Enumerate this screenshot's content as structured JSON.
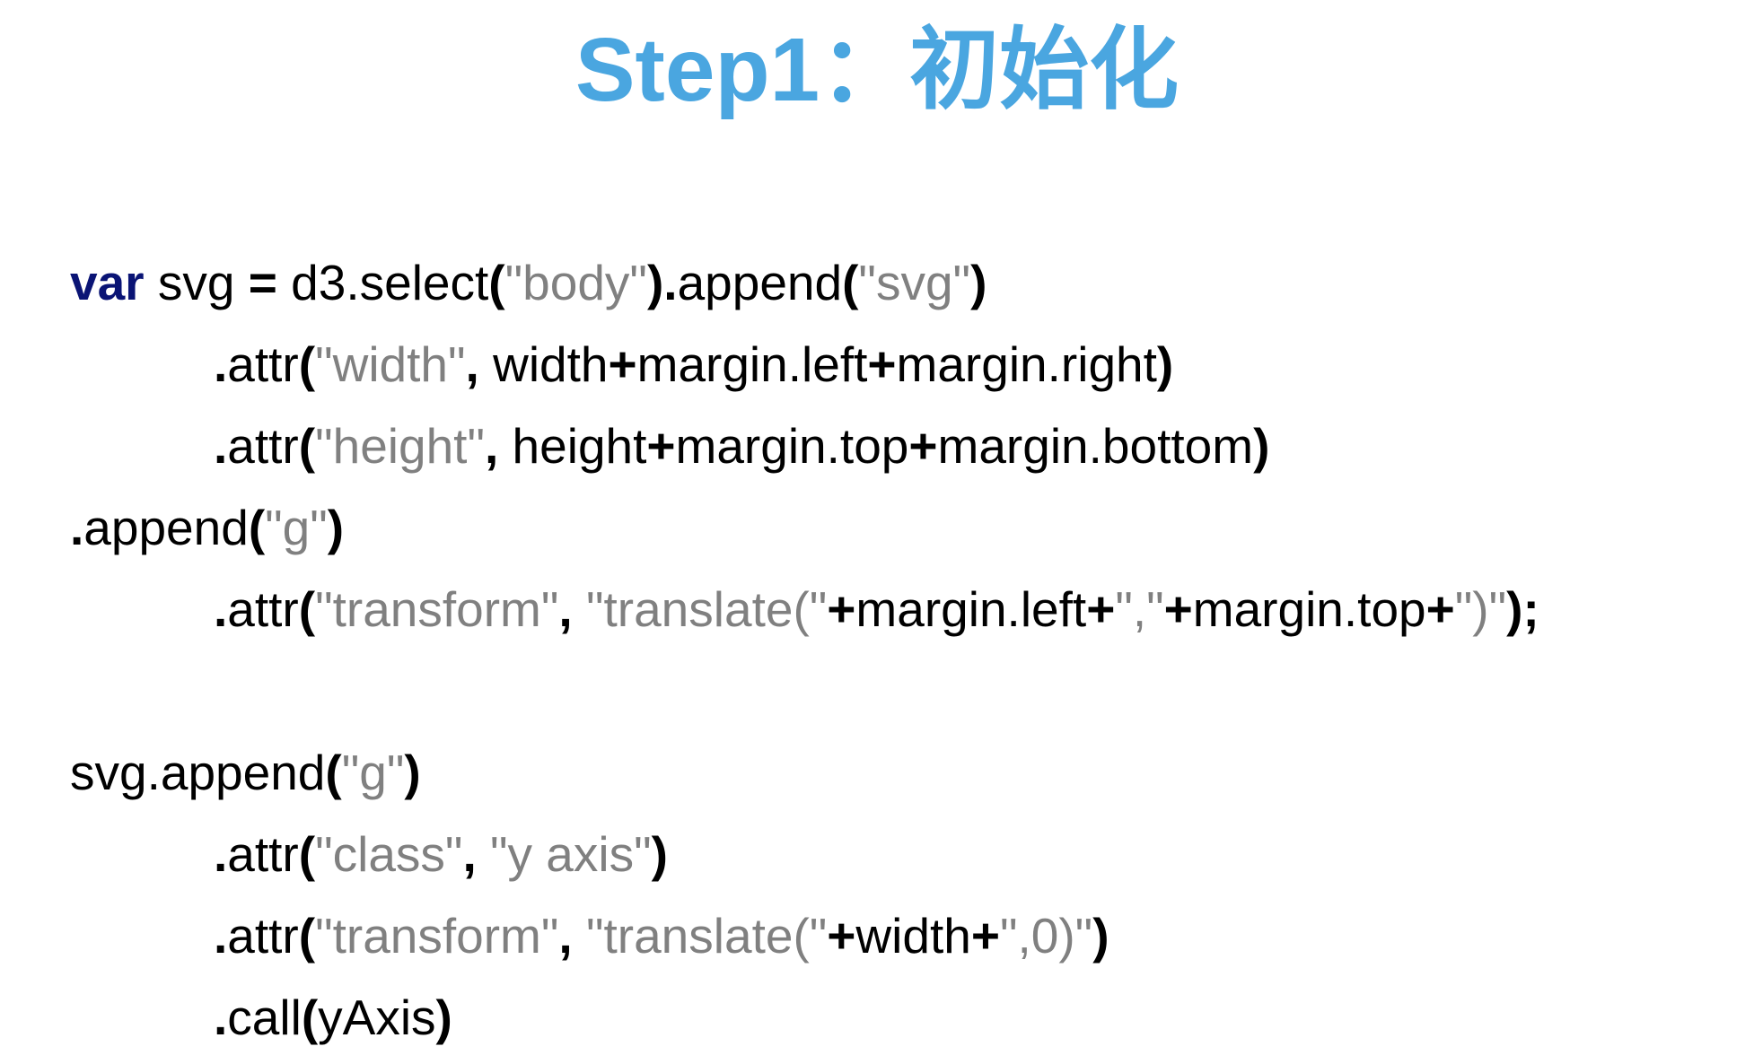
{
  "colors": {
    "title": "#4aa6e0",
    "keyword": "#0a1475",
    "string": "#808080",
    "text": "#000000"
  },
  "slide": {
    "title": "Step1：初始化"
  },
  "code": {
    "lines": [
      {
        "indent": false,
        "tokens": [
          {
            "t": "kw",
            "v": "var"
          },
          {
            "t": "plain",
            "v": " svg "
          },
          {
            "t": "op",
            "v": "="
          },
          {
            "t": "plain",
            "v": " d3.select"
          },
          {
            "t": "punct",
            "v": "("
          },
          {
            "t": "str",
            "v": "\"body\""
          },
          {
            "t": "punct",
            "v": ")."
          },
          {
            "t": "plain",
            "v": "append"
          },
          {
            "t": "punct",
            "v": "("
          },
          {
            "t": "str",
            "v": "\"svg\""
          },
          {
            "t": "punct",
            "v": ")"
          }
        ]
      },
      {
        "indent": true,
        "tokens": [
          {
            "t": "punct",
            "v": "."
          },
          {
            "t": "plain",
            "v": "attr"
          },
          {
            "t": "punct",
            "v": "("
          },
          {
            "t": "str",
            "v": "\"width\""
          },
          {
            "t": "punct",
            "v": ","
          },
          {
            "t": "plain",
            "v": " width"
          },
          {
            "t": "op",
            "v": "+"
          },
          {
            "t": "plain",
            "v": "margin.left"
          },
          {
            "t": "op",
            "v": "+"
          },
          {
            "t": "plain",
            "v": "margin.right"
          },
          {
            "t": "punct",
            "v": ")"
          }
        ]
      },
      {
        "indent": true,
        "tokens": [
          {
            "t": "punct",
            "v": "."
          },
          {
            "t": "plain",
            "v": "attr"
          },
          {
            "t": "punct",
            "v": "("
          },
          {
            "t": "str",
            "v": "\"height\""
          },
          {
            "t": "punct",
            "v": ","
          },
          {
            "t": "plain",
            "v": " height"
          },
          {
            "t": "op",
            "v": "+"
          },
          {
            "t": "plain",
            "v": "margin.top"
          },
          {
            "t": "op",
            "v": "+"
          },
          {
            "t": "plain",
            "v": "margin.bottom"
          },
          {
            "t": "punct",
            "v": ")"
          }
        ]
      },
      {
        "indent": false,
        "tokens": [
          {
            "t": "punct",
            "v": "."
          },
          {
            "t": "plain",
            "v": "append"
          },
          {
            "t": "punct",
            "v": "("
          },
          {
            "t": "str",
            "v": "\"g\""
          },
          {
            "t": "punct",
            "v": ")"
          }
        ]
      },
      {
        "indent": true,
        "tokens": [
          {
            "t": "punct",
            "v": "."
          },
          {
            "t": "plain",
            "v": "attr"
          },
          {
            "t": "punct",
            "v": "("
          },
          {
            "t": "str",
            "v": "\"transform\""
          },
          {
            "t": "punct",
            "v": ","
          },
          {
            "t": "plain",
            "v": " "
          },
          {
            "t": "str",
            "v": "\"translate(\""
          },
          {
            "t": "op",
            "v": "+"
          },
          {
            "t": "plain",
            "v": "margin.left"
          },
          {
            "t": "op",
            "v": "+"
          },
          {
            "t": "str",
            "v": "\",\""
          },
          {
            "t": "op",
            "v": "+"
          },
          {
            "t": "plain",
            "v": "margin.top"
          },
          {
            "t": "op",
            "v": "+"
          },
          {
            "t": "str",
            "v": "\")\""
          },
          {
            "t": "punct",
            "v": ");"
          }
        ]
      },
      {
        "indent": false,
        "tokens": []
      },
      {
        "indent": false,
        "tokens": [
          {
            "t": "plain",
            "v": "svg.append"
          },
          {
            "t": "punct",
            "v": "("
          },
          {
            "t": "str",
            "v": "\"g\""
          },
          {
            "t": "punct",
            "v": ")"
          }
        ]
      },
      {
        "indent": true,
        "tokens": [
          {
            "t": "punct",
            "v": "."
          },
          {
            "t": "plain",
            "v": "attr"
          },
          {
            "t": "punct",
            "v": "("
          },
          {
            "t": "str",
            "v": "\"class\""
          },
          {
            "t": "punct",
            "v": ","
          },
          {
            "t": "plain",
            "v": " "
          },
          {
            "t": "str",
            "v": "\"y axis\""
          },
          {
            "t": "punct",
            "v": ")"
          }
        ]
      },
      {
        "indent": true,
        "tokens": [
          {
            "t": "punct",
            "v": "."
          },
          {
            "t": "plain",
            "v": "attr"
          },
          {
            "t": "punct",
            "v": "("
          },
          {
            "t": "str",
            "v": "\"transform\""
          },
          {
            "t": "punct",
            "v": ","
          },
          {
            "t": "plain",
            "v": " "
          },
          {
            "t": "str",
            "v": "\"translate(\""
          },
          {
            "t": "op",
            "v": "+"
          },
          {
            "t": "plain",
            "v": "width"
          },
          {
            "t": "op",
            "v": "+"
          },
          {
            "t": "str",
            "v": "\",0)\""
          },
          {
            "t": "punct",
            "v": ")"
          }
        ]
      },
      {
        "indent": true,
        "tokens": [
          {
            "t": "punct",
            "v": "."
          },
          {
            "t": "plain",
            "v": "call"
          },
          {
            "t": "punct",
            "v": "("
          },
          {
            "t": "plain",
            "v": "yAxis"
          },
          {
            "t": "punct",
            "v": ")"
          }
        ]
      }
    ]
  }
}
